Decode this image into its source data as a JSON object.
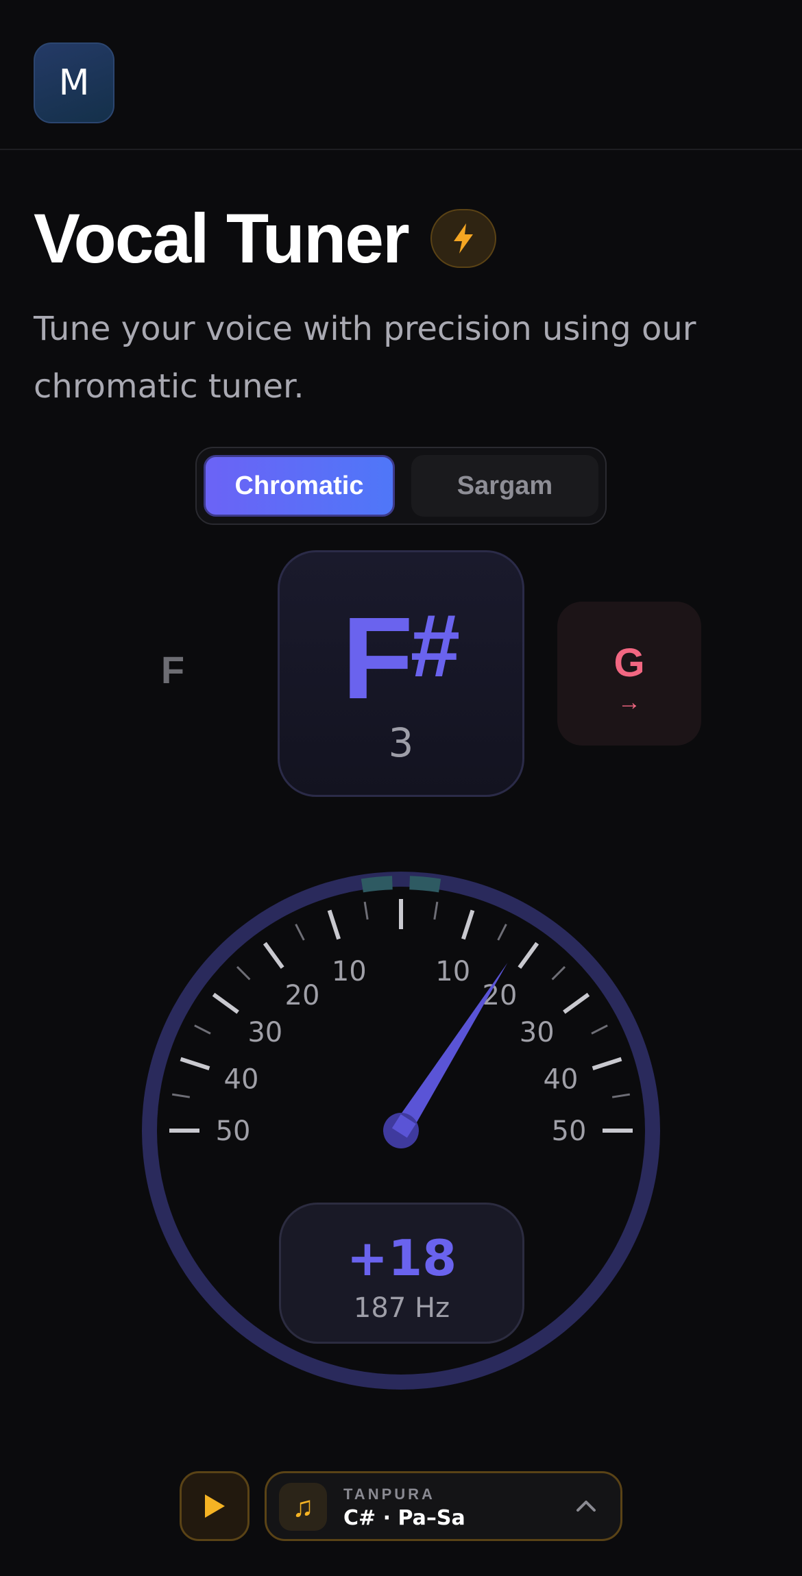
{
  "header": {
    "avatar_initial": "M"
  },
  "page": {
    "title": "Vocal Tuner",
    "subtitle": "Tune your voice with precision using our chromatic tuner."
  },
  "mode_toggle": {
    "options": [
      {
        "label": "Chromatic",
        "active": true
      },
      {
        "label": "Sargam",
        "active": false
      }
    ]
  },
  "notes": {
    "previous": "F",
    "current_letter": "F",
    "current_accidental": "#",
    "current_octave": "3",
    "next": "G",
    "next_arrow": "→"
  },
  "gauge": {
    "scale_labels_left": [
      "50",
      "40",
      "30",
      "20",
      "10"
    ],
    "scale_labels_right": [
      "10",
      "20",
      "30",
      "40",
      "50"
    ],
    "cents_value": 18,
    "cents_display": "+18",
    "frequency_display": "187 Hz"
  },
  "tanpura": {
    "kicker": "TANPURA",
    "value": "C# · Pa–Sa"
  },
  "colors": {
    "accent": "#6a63ee",
    "next_note": "#f26782",
    "tanpura_gold": "#f5b324",
    "background": "#0b0b0d"
  },
  "icons": {
    "badge": "lightning-bolt-icon",
    "play": "play-icon",
    "tanpura": "music-note-icon",
    "expand": "chevron-up-icon"
  }
}
